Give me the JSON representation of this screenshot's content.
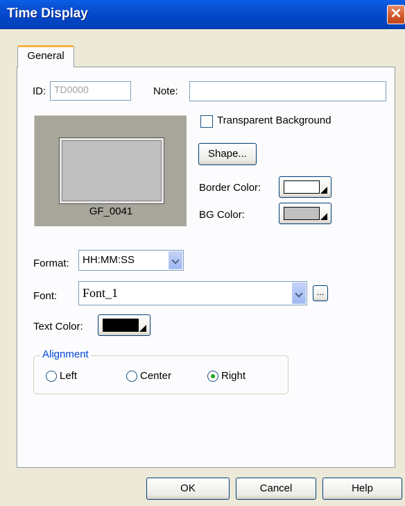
{
  "window": {
    "title": "Time Display",
    "close_glyph": "✕"
  },
  "tabs": [
    {
      "label": "General",
      "active": true
    }
  ],
  "id_field": {
    "label": "ID:",
    "value": "TD0000"
  },
  "note_field": {
    "label": "Note:",
    "value": ""
  },
  "preview": {
    "caption": "GF_0041"
  },
  "transparent_background": {
    "label": "Transparent Background",
    "checked": false
  },
  "shape_button": {
    "label": "Shape..."
  },
  "border_color": {
    "label": "Border Color:",
    "color": "#ffffff"
  },
  "bg_color": {
    "label": "BG Color:",
    "color": "#c0c0c0"
  },
  "format": {
    "label": "Format:",
    "value": "HH:MM:SS"
  },
  "font": {
    "label": "Font:",
    "value": "Font_1",
    "browse_label": "..."
  },
  "text_color": {
    "label": "Text Color:",
    "color": "#000000"
  },
  "alignment": {
    "title": "Alignment",
    "options": [
      {
        "label": "Left",
        "selected": false
      },
      {
        "label": "Center",
        "selected": false
      },
      {
        "label": "Right",
        "selected": true
      }
    ]
  },
  "footer": {
    "ok_label": "OK",
    "cancel_label": "Cancel",
    "help_label": "Help"
  }
}
